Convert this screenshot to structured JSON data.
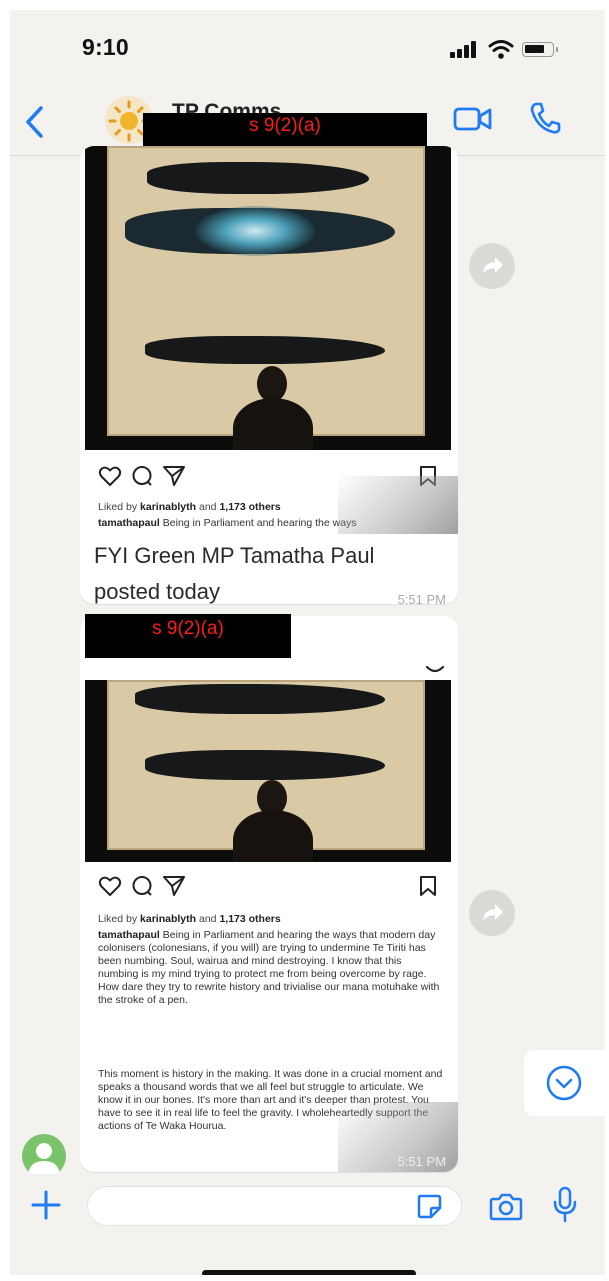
{
  "status_bar": {
    "time": "9:10"
  },
  "header": {
    "group_name": "TP Comms"
  },
  "redactions": [
    "s 9(2)(a)",
    "s 9(2)(a)"
  ],
  "messages": [
    {
      "ig_likes": {
        "prefix": "Liked by",
        "user": "karinablyth",
        "mid": "and",
        "count": "1,173 others"
      },
      "ig_caption_user": "tamathapaul",
      "ig_caption_text": "Being in Parliament and hearing the ways",
      "text": "FYI Green MP Tamatha Paul posted today",
      "time": "5:51 PM"
    },
    {
      "ig_likes": {
        "prefix": "Liked by",
        "user": "karinablyth",
        "mid": "and",
        "count": "1,173 others"
      },
      "ig_caption_user": "tamathapaul",
      "ig_caption_p1": "Being in Parliament and hearing the ways that modern day colonisers (colonesians, if you will) are trying to undermine Te Tiriti has been numbing. Soul, wairua and mind destroying. I know that this numbing is my mind trying to protect me from being overcome by rage. How dare they try to rewrite history and trivialise our mana motuhake with the stroke of a pen.",
      "ig_caption_p2": "This moment is history in the making. It was done in a crucial moment and speaks a thousand words that we all feel but struggle to articulate. We know it in our bones. It's more than art and it's deeper than protest. You have to see it in real life to feel the gravity. I wholeheartedly support the actions of Te Waka Hourua.",
      "time": "5:51 PM"
    }
  ],
  "icons": {
    "back": "chevron-left-icon",
    "video": "video-camera-icon",
    "call": "phone-icon",
    "like": "heart-icon",
    "comment": "comment-icon",
    "share": "send-icon",
    "save": "bookmark-icon",
    "forward": "forward-icon",
    "scroll_down": "chevron-down-circle-icon",
    "plus": "plus-icon",
    "sticker": "sticker-icon",
    "camera": "camera-icon",
    "mic": "microphone-icon"
  },
  "colors": {
    "accent": "#1f7bf2",
    "background": "#f3f2ef",
    "redaction_text": "#ff1a1a"
  }
}
